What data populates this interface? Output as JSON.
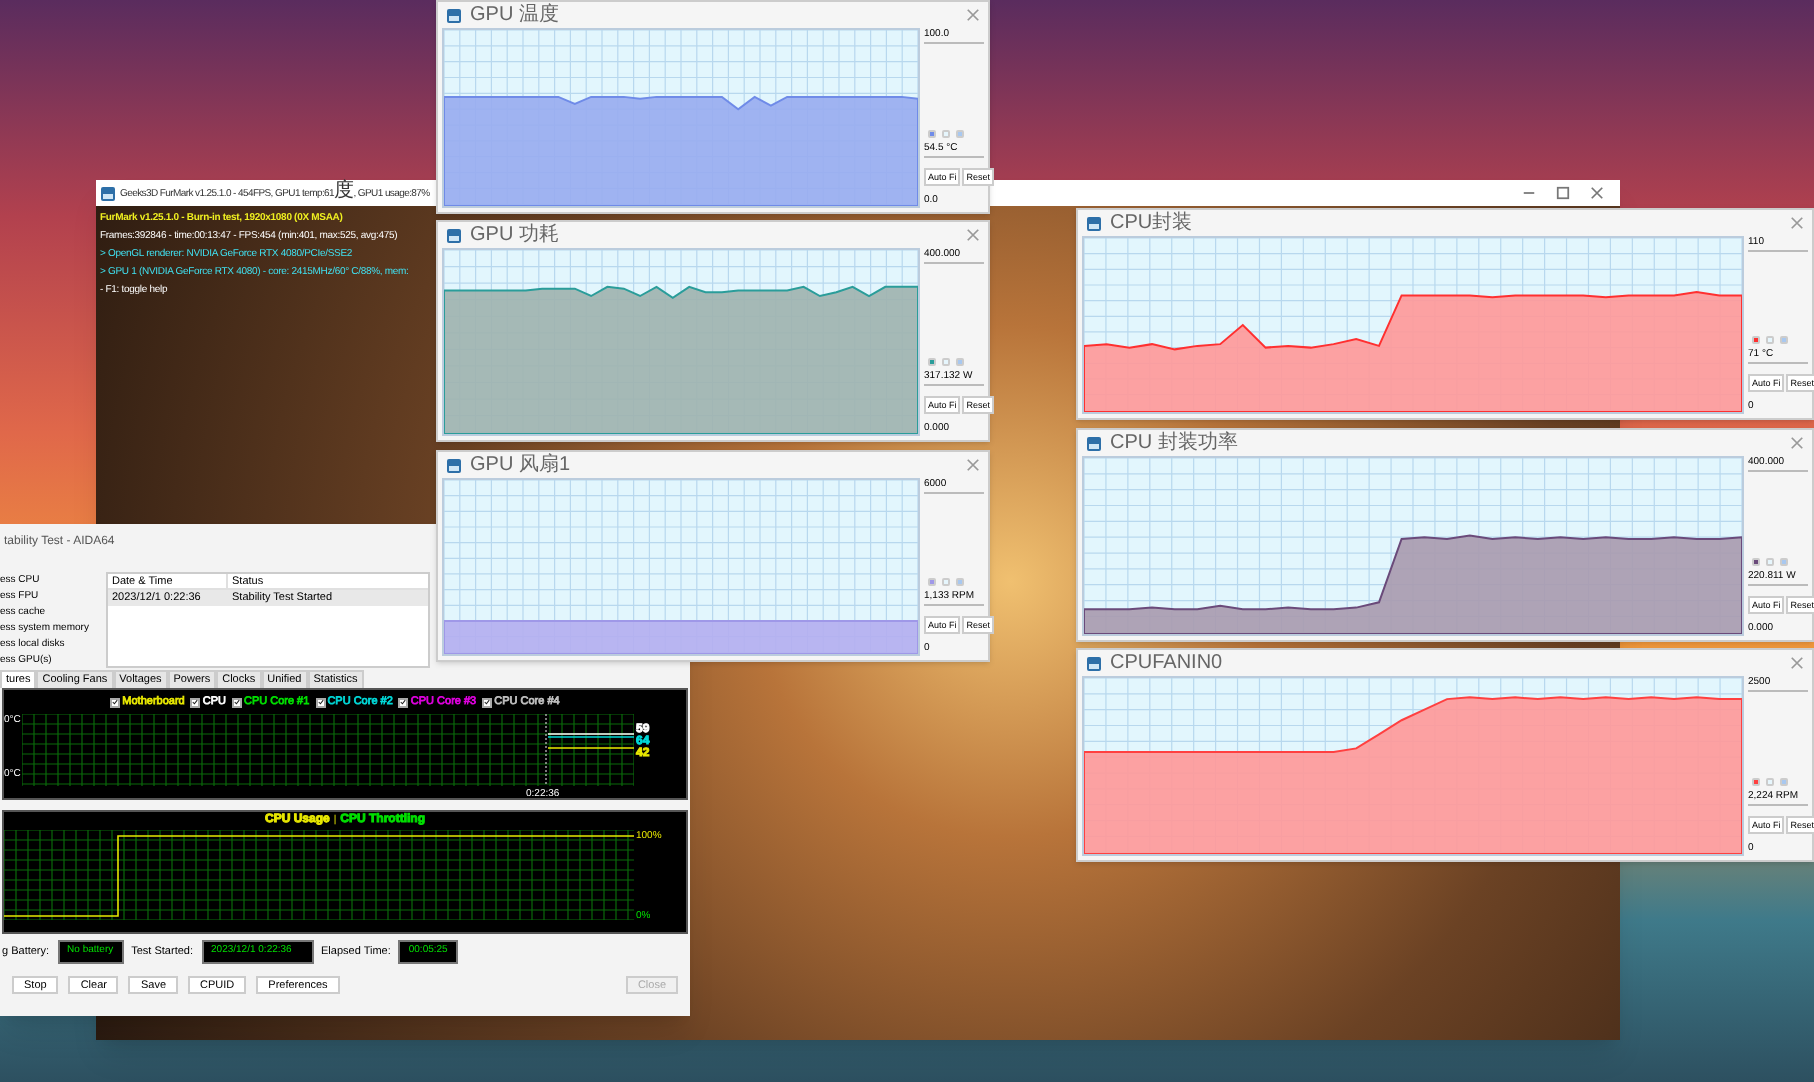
{
  "furmark": {
    "title": "Geeks3D FurMark v1.25.1.0 - 454FPS, GPU1 temp:61度, GPU1 usage:87%",
    "overlay_lines": [
      {
        "kind": "heading",
        "text": "FurMark v1.25.1.0 - Burn-in test, 1920x1080 (0X MSAA)"
      },
      {
        "kind": "info",
        "text": "Frames:392846 - time:00:13:47 - FPS:454 (min:401, max:525, avg:475)"
      },
      {
        "kind": "device",
        "text": "> OpenGL renderer: NVIDIA GeForce RTX 4080/PCIe/SSE2"
      },
      {
        "kind": "device",
        "text": "> GPU 1 (NVIDIA GeForce RTX 4080) - core: 2415MHz/60° C/88%, mem:"
      },
      {
        "kind": "info",
        "text": "- F1: toggle help"
      }
    ]
  },
  "aida64": {
    "title": "tability Test - AIDA64",
    "stress_options": [
      "ess CPU",
      "ess FPU",
      "ess cache",
      "ess system memory",
      "ess local disks",
      "ess GPU(s)"
    ],
    "log_table": {
      "columns": [
        "Date & Time",
        "Status"
      ],
      "rows": [
        [
          "2023/12/1 0:22:36",
          "Stability Test Started"
        ]
      ]
    },
    "tabs": [
      {
        "label": "tures",
        "selected": true
      },
      {
        "label": "Cooling Fans",
        "selected": false
      },
      {
        "label": "Voltages",
        "selected": false
      },
      {
        "label": "Powers",
        "selected": false
      },
      {
        "label": "Clocks",
        "selected": false
      },
      {
        "label": "Unified",
        "selected": false
      },
      {
        "label": "Statistics",
        "selected": false
      }
    ],
    "temperature_chart": {
      "legend": [
        {
          "label": "Motherboard",
          "color": "#e8e800",
          "checked": true
        },
        {
          "label": "CPU",
          "color": "#ffffff",
          "checked": true
        },
        {
          "label": "CPU Core #1",
          "color": "#00e000",
          "checked": true
        },
        {
          "label": "CPU Core #2",
          "color": "#00d8d8",
          "checked": true
        },
        {
          "label": "CPU Core #3",
          "color": "#e000e0",
          "checked": true
        },
        {
          "label": "CPU Core #4",
          "color": "#c0c0c0",
          "checked": true
        }
      ],
      "axis_top": "0°C",
      "axis_bottom": "0°C",
      "time_label": "0:22:36",
      "readings": [
        {
          "text": "59",
          "color": "#ffffff"
        },
        {
          "text": "64",
          "color": "#00d8d8"
        },
        {
          "text": "42",
          "color": "#e8e800"
        }
      ]
    },
    "usage_chart": {
      "legend": [
        {
          "label": "CPU Usage",
          "color": "#e8e800"
        },
        {
          "label": "CPU Throttling",
          "color": "#00e000"
        }
      ],
      "separator": "|",
      "top_label": "100%",
      "bottom_label": "0%"
    },
    "status": [
      {
        "label": "g Battery:",
        "value": "No battery"
      },
      {
        "label": "Test Started:",
        "value": "2023/12/1 0:22:36"
      },
      {
        "label": "Elapsed Time:",
        "value": "00:05:25"
      }
    ],
    "buttons": [
      {
        "label": "Stop",
        "disabled": false
      },
      {
        "label": "Clear",
        "disabled": false
      },
      {
        "label": "Save",
        "disabled": false
      },
      {
        "label": "CPUID",
        "disabled": false
      },
      {
        "label": "Preferences",
        "disabled": false
      },
      {
        "label": "Close",
        "disabled": true
      }
    ]
  },
  "monitor_windows": [
    {
      "title": "GPU 温度",
      "max_label": "100.0",
      "reading": "54.5 °C",
      "buttons": [
        "Auto Fi",
        "Reset"
      ],
      "min_label": "0.0"
    },
    {
      "title": "GPU 功耗",
      "max_label": "400.000",
      "reading": "317.132 W",
      "buttons": [
        "Auto Fi",
        "Reset"
      ],
      "min_label": "0.000"
    },
    {
      "title": "GPU 风扇1",
      "max_label": "6000",
      "reading": "1,133 RPM",
      "buttons": [
        "Auto Fi",
        "Reset"
      ],
      "min_label": "0"
    },
    {
      "title": "CPU封装",
      "max_label": "110",
      "reading": "71 °C",
      "buttons": [
        "Auto Fi",
        "Reset"
      ],
      "min_label": "0"
    },
    {
      "title": "CPU 封装功率",
      "max_label": "400.000",
      "reading": "220.811 W",
      "buttons": [
        "Auto Fi",
        "Reset"
      ],
      "min_label": "0.000"
    },
    {
      "title": "CPUFANIN0",
      "max_label": "2500",
      "reading": "2,224 RPM",
      "buttons": [
        "Auto Fi",
        "Reset"
      ],
      "min_label": "0"
    }
  ]
}
